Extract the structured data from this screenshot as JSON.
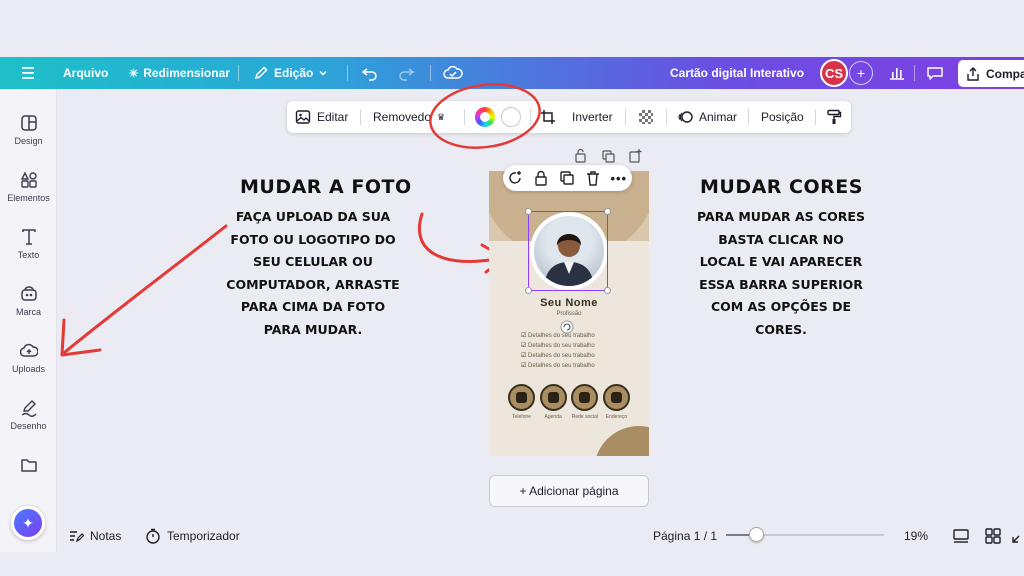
{
  "header": {
    "menu_icon": "hamburger-icon",
    "file_label": "Arquivo",
    "resize_label": "Redimensionar",
    "edit_label": "Edição",
    "doc_title": "Cartão digital Interativo",
    "avatar_initials": "CS",
    "share_label": "Compa",
    "gradient_start": "#1ec0c8",
    "gradient_end": "#7f3fe3"
  },
  "sidebar": {
    "items": [
      {
        "label": "Design",
        "icon": "design-icon"
      },
      {
        "label": "Elementos",
        "icon": "elements-icon"
      },
      {
        "label": "Texto",
        "icon": "text-icon"
      },
      {
        "label": "Marca",
        "icon": "brand-icon"
      },
      {
        "label": "Uploads",
        "icon": "upload-icon"
      },
      {
        "label": "Desenho",
        "icon": "draw-icon"
      },
      {
        "label": "",
        "icon": "folder-icon"
      }
    ]
  },
  "context_toolbar": {
    "edit_label": "Editar",
    "remove_label": "Removedo",
    "flip_label": "Inverter",
    "animate_label": "Animar",
    "position_label": "Posição"
  },
  "annotations": {
    "left_title": "MUDAR A FOTO",
    "left_lines": [
      "FAÇA UPLOAD DA SUA",
      "FOTO OU LOGOTIPO DO",
      "SEU CELULAR OU",
      "COMPUTADOR, ARRASTE",
      "PARA CIMA DA FOTO",
      "PARA MUDAR."
    ],
    "right_title": "MUDAR CORES",
    "right_lines": [
      "PARA MUDAR AS CORES",
      "BASTA CLICAR NO",
      "LOCAL E VAI APARECER",
      "ESSA BARRA SUPERIOR",
      "COM AS OPÇÕES DE",
      "CORES."
    ],
    "arrow_color": "#e53935"
  },
  "card": {
    "name": "Seu Nome",
    "role": "Profissão",
    "details": [
      "Detalhes do seu trabalho",
      "Detalhes do seu trabalho",
      "Detalhes do seu trabalho",
      "Detalhes do seu trabalho"
    ],
    "icons": [
      {
        "label": "Telefone",
        "icon": "phone-icon"
      },
      {
        "label": "Agenda",
        "icon": "calendar-icon"
      },
      {
        "label": "Rede social",
        "icon": "social-icon"
      },
      {
        "label": "Endereço",
        "icon": "location-icon"
      }
    ]
  },
  "add_page_label": "+ Adicionar página",
  "footer": {
    "notes_label": "Notas",
    "timer_label": "Temporizador",
    "page_label": "Página 1 / 1",
    "zoom_label": "19%",
    "zoom_fraction": 0.15
  }
}
